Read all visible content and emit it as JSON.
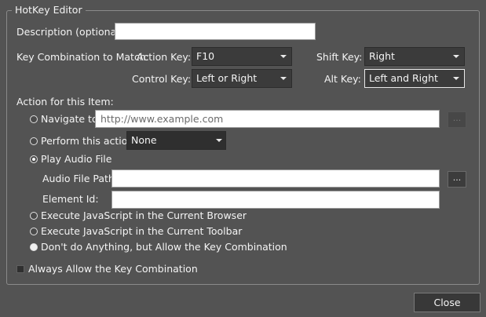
{
  "window": {
    "group_title": "HotKey Editor"
  },
  "description": {
    "label": "Description (optional):",
    "value": ""
  },
  "key_combo": {
    "label": "Key Combination to Match:",
    "action_key": {
      "label": "Action Key:",
      "value": "F10"
    },
    "shift_key": {
      "label": "Shift Key:",
      "value": "Right"
    },
    "control_key": {
      "label": "Control Key:",
      "value": "Left or Right"
    },
    "alt_key": {
      "label": "Alt Key:",
      "value": "Left and Right"
    }
  },
  "action": {
    "label": "Action for this Item:",
    "navigate": {
      "label": "Navigate to:",
      "placeholder": "http://www.example.com",
      "browse": "..."
    },
    "perform": {
      "label": "Perform this action:",
      "value": "None"
    },
    "play_audio": {
      "label": "Play Audio File",
      "path_label": "Audio File Path:",
      "path_value": "",
      "browse": "...",
      "element_label": "Element Id:",
      "element_value": ""
    },
    "exec_browser": {
      "label": "Execute JavaScript in the Current Browser"
    },
    "exec_toolbar": {
      "label": "Execute JavaScript in the Current Toolbar"
    },
    "dont_do": {
      "label": "Don't do Anything, but Allow the Key Combination"
    }
  },
  "always_allow": {
    "label": "Always Allow the Key Combination",
    "checked": false
  },
  "footer": {
    "close_label": "Close"
  }
}
